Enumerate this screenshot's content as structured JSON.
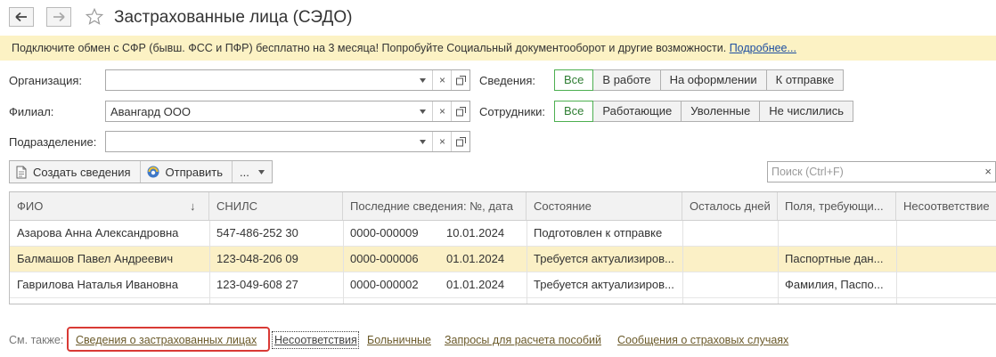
{
  "window": {
    "title": "Застрахованные лица (СЭДО)"
  },
  "banner": {
    "text": "Подключите обмен с СФР (бывш. ФСС и ПФР) бесплатно на 3 месяца! Попробуйте Социальный документооборот и другие возможности. ",
    "link": "Подробнее..."
  },
  "filters": {
    "organization_label": "Организация:",
    "organization_value": "",
    "branch_label": "Филиал:",
    "branch_value": "Авангард ООО",
    "department_label": "Подразделение:",
    "department_value": ""
  },
  "info_filter": {
    "label": "Сведения:",
    "options": [
      "Все",
      "В работе",
      "На оформлении",
      "К отправке"
    ],
    "selected": "Все"
  },
  "employees_filter": {
    "label": "Сотрудники:",
    "options": [
      "Все",
      "Работающие",
      "Уволенные",
      "Не числились"
    ],
    "selected": "Все"
  },
  "toolbar": {
    "create_label": "Создать сведения",
    "send_label": "Отправить",
    "more_label": "...",
    "search_placeholder": "Поиск (Ctrl+F)"
  },
  "table": {
    "columns": [
      "ФИО",
      "СНИЛС",
      "Последние сведения: №, дата",
      "Состояние",
      "Осталось дней",
      "Поля, требующи...",
      "Несоответствие"
    ],
    "sort_indicator": "↓",
    "rows": [
      {
        "fio": "Азарова Анна Александровна",
        "snils": "547-486-252 30",
        "num": "0000-000009",
        "date": "10.01.2024",
        "state": "Подготовлен к отправке",
        "days": "",
        "fields": "",
        "mismatch": "",
        "selected": false
      },
      {
        "fio": "Балмашов Павел Андреевич",
        "snils": "123-048-206 09",
        "num": "0000-000006",
        "date": "01.01.2024",
        "state": "Требуется актуализиров...",
        "days": "",
        "fields": "Паспортные дан...",
        "mismatch": "",
        "selected": true
      },
      {
        "fio": "Гаврилова Наталья Ивановна",
        "snils": "123-049-608 27",
        "num": "0000-000002",
        "date": "01.01.2024",
        "state": "Требуется актуализиров...",
        "days": "",
        "fields": "Фамилия, Паспо...",
        "mismatch": "",
        "selected": false
      }
    ]
  },
  "see_also": {
    "label": "См. также:",
    "links": [
      "Сведения о застрахованных лицах",
      "Несоответствия",
      "Больничные",
      "Запросы для расчета пособий",
      "Сообщения о страховых случаях"
    ]
  },
  "colors": {
    "banner_bg": "#fcf2c4",
    "selected_row_bg": "#fbf0c6",
    "active_option": "#4caf50",
    "highlight_box": "#d93a35"
  }
}
